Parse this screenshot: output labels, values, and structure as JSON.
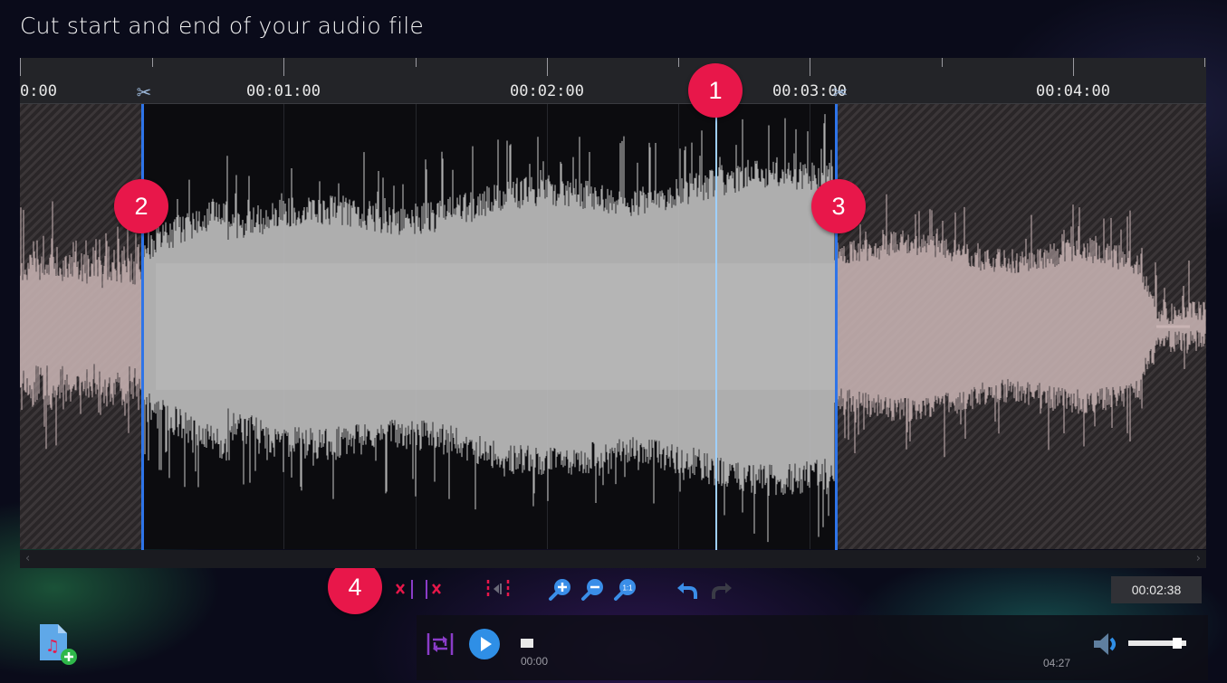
{
  "title": "Cut start and end of your audio file",
  "ruler": {
    "labels": [
      "0:00",
      "00:01:00",
      "00:02:00",
      "00:03:00",
      "00:04:00"
    ]
  },
  "badges": [
    "1",
    "2",
    "3",
    "4"
  ],
  "toolbar": {
    "cut_start_icon": "cut-start-icon",
    "cut_end_icon": "cut-end-icon",
    "split_icon": "split-icon",
    "zoom_in_icon": "zoom-in-icon",
    "zoom_out_icon": "zoom-out-icon",
    "zoom_reset_icon": "zoom-reset-icon",
    "undo_icon": "undo-icon",
    "redo_icon": "redo-icon",
    "current_time": "00:02:38"
  },
  "player": {
    "start_time": "00:00",
    "end_time": "04:27",
    "progress": 0.0,
    "volume": 0.9
  },
  "colors": {
    "accent_red": "#e8174a",
    "marker_blue": "#2e74e8",
    "playhead": "#9fd0ff",
    "wave_active": "#bcbcbc",
    "wave_cut": "#c9b4b4"
  }
}
